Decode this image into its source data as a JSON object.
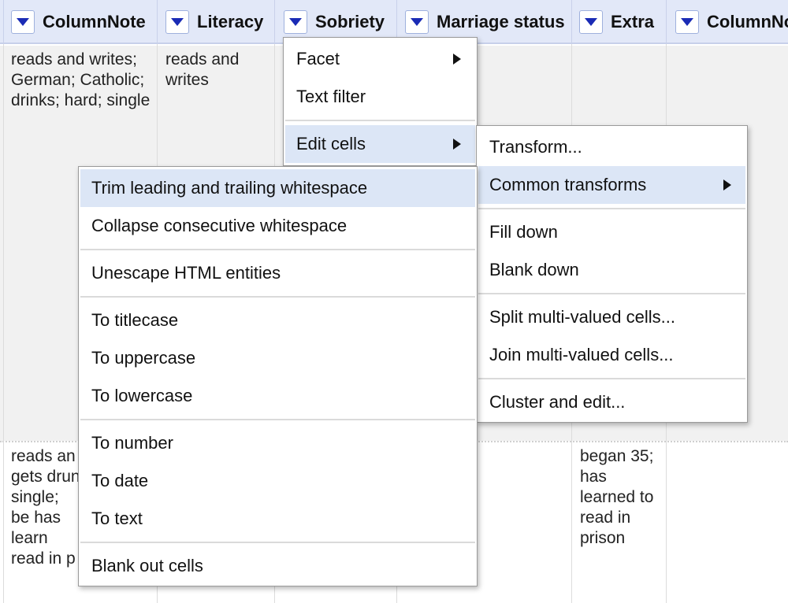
{
  "header": {
    "col0": "ColumnNote",
    "col1": "Literacy",
    "col2": "Sobriety",
    "col3": "Marriage status",
    "col4": "Extra",
    "col5": "ColumnNote"
  },
  "rows": [
    {
      "columnnote": "reads and writes; German; Catholic; drinks; hard; single",
      "literacy": "reads and writes",
      "extra": ""
    },
    {
      "columnnote": "reads an gets drun single; be has learn read in p",
      "literacy": "",
      "extra": "began 35; has learned to read in prison"
    }
  ],
  "column_menu": {
    "items": [
      "Facet",
      "Text filter",
      "Edit cells"
    ]
  },
  "edit_cells_menu": {
    "items": [
      "Transform...",
      "Common transforms",
      "Fill down",
      "Blank down",
      "Split multi-valued cells...",
      "Join multi-valued cells...",
      "Cluster and edit..."
    ]
  },
  "common_transforms_menu": {
    "items": [
      "Trim leading and trailing whitespace",
      "Collapse consecutive whitespace",
      "Unescape HTML entities",
      "To titlecase",
      "To uppercase",
      "To lowercase",
      "To number",
      "To date",
      "To text",
      "Blank out cells"
    ]
  },
  "colors": {
    "header_bg": "#e2e8f8",
    "dropdown_arrow": "#1a2bb5",
    "menu_highlight": "#dce6f6",
    "row_odd_bg": "#f1f1f1"
  }
}
